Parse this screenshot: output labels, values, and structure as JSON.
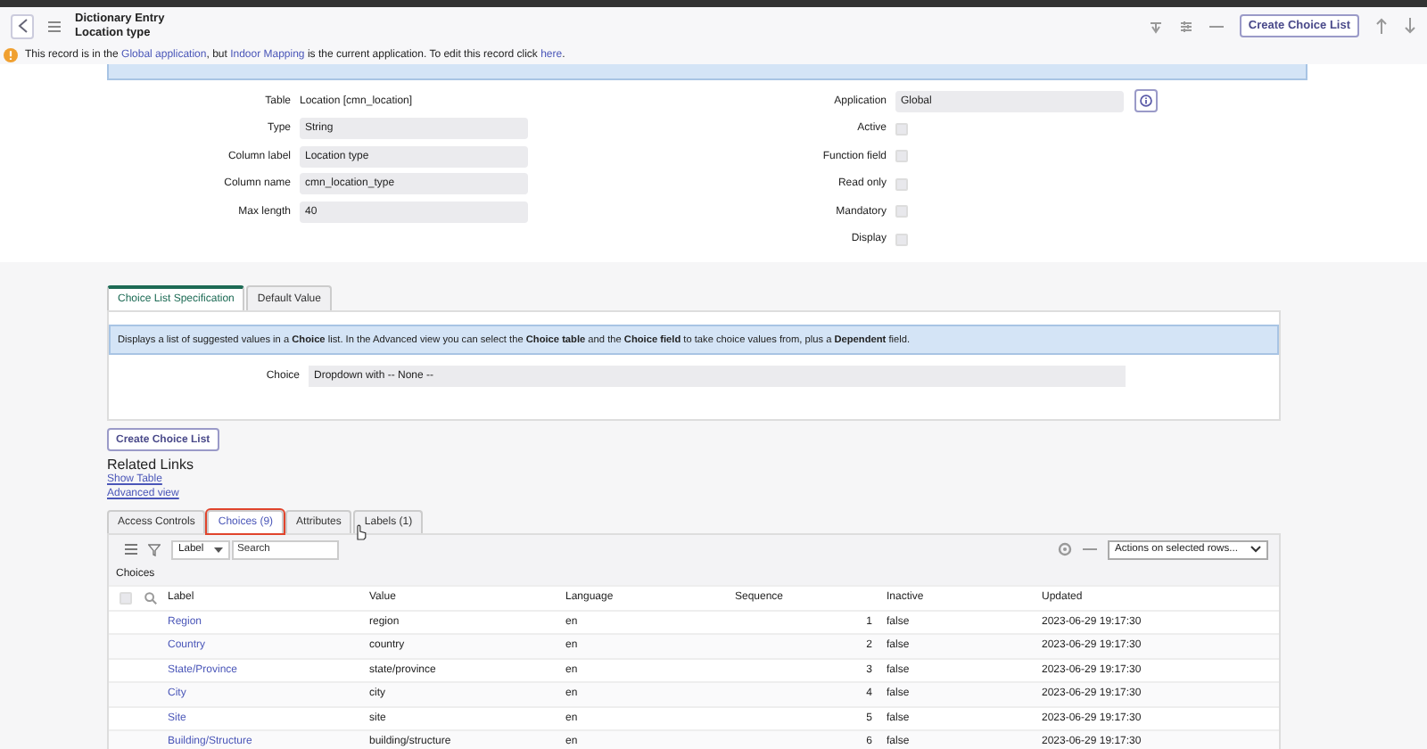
{
  "header": {
    "title": "Dictionary Entry",
    "subtitle": "Location type",
    "action_button": "Create Choice List"
  },
  "notice": {
    "parts": [
      {
        "text": "This record is in the ",
        "link": false
      },
      {
        "text": "Global",
        "link": true
      },
      {
        "text": " application",
        "link": true
      },
      {
        "text": ", but ",
        "link": false
      },
      {
        "text": "Indoor Mapping",
        "link": true
      },
      {
        "text": " is the current application. To edit this record click ",
        "link": false
      },
      {
        "text": "here",
        "link": true
      },
      {
        "text": ".",
        "link": false
      }
    ]
  },
  "form_left": [
    {
      "label": "Table",
      "kind": "text",
      "value": "Location [cmn_location]"
    },
    {
      "label": "Type",
      "kind": "field",
      "value": "String"
    },
    {
      "label": "Column label",
      "kind": "field",
      "value": "Location type"
    },
    {
      "label": "Column name",
      "kind": "field",
      "value": "cmn_location_type"
    },
    {
      "label": "Max length",
      "kind": "field",
      "value": "40"
    }
  ],
  "form_right": [
    {
      "label": "Application",
      "kind": "field",
      "value": "Global"
    },
    {
      "label": "Active",
      "kind": "checkbox",
      "checked": false
    },
    {
      "label": "Function field",
      "kind": "checkbox",
      "checked": false
    },
    {
      "label": "Read only",
      "kind": "checkbox",
      "checked": false
    },
    {
      "label": "Mandatory",
      "kind": "checkbox",
      "checked": false
    },
    {
      "label": "Display",
      "kind": "checkbox",
      "checked": false
    }
  ],
  "section_tabs": [
    {
      "label": "Choice List Specification",
      "selected": true
    },
    {
      "label": "Default Value",
      "selected": false
    }
  ],
  "info": "Displays a list of suggested values in a **Choice** list. In the Advanced view you can select the **Choice table** and the **Choice field** to take choice values from, plus a **Dependent** field.",
  "choice": {
    "label": "Choice",
    "value": "Dropdown with -- None --"
  },
  "create_button": "Create Choice List",
  "related_links": {
    "title": "Related Links",
    "links": [
      "Show Table",
      "Advanced view"
    ]
  },
  "related_tabs": [
    {
      "label": "Access Controls",
      "selected": false,
      "highlighted": false
    },
    {
      "label": "Choices (9)",
      "selected": true,
      "highlighted": true
    },
    {
      "label": "Attributes",
      "selected": false,
      "highlighted": false
    },
    {
      "label": "Labels (1)",
      "selected": false,
      "highlighted": false
    }
  ],
  "list": {
    "filter_field": "Label",
    "search_placeholder": "Search",
    "select_all_checked": false,
    "actions": "Actions on selected rows...",
    "title": "Choices",
    "columns": [
      "Label",
      "Value",
      "Language",
      "Sequence",
      "Inactive",
      "Updated"
    ],
    "rows": [
      [
        "Region",
        "region",
        "en",
        "1",
        "false",
        "2023-06-29 19:17:30"
      ],
      [
        "Country",
        "country",
        "en",
        "2",
        "false",
        "2023-06-29 19:17:30"
      ],
      [
        "State/Province",
        "state/province",
        "en",
        "3",
        "false",
        "2023-06-29 19:17:30"
      ],
      [
        "City",
        "city",
        "en",
        "4",
        "false",
        "2023-06-29 19:17:30"
      ],
      [
        "Site",
        "site",
        "en",
        "5",
        "false",
        "2023-06-29 19:17:30"
      ],
      [
        "Building/Structure",
        "building/structure",
        "en",
        "6",
        "false",
        "2023-06-29 19:17:30"
      ]
    ]
  }
}
